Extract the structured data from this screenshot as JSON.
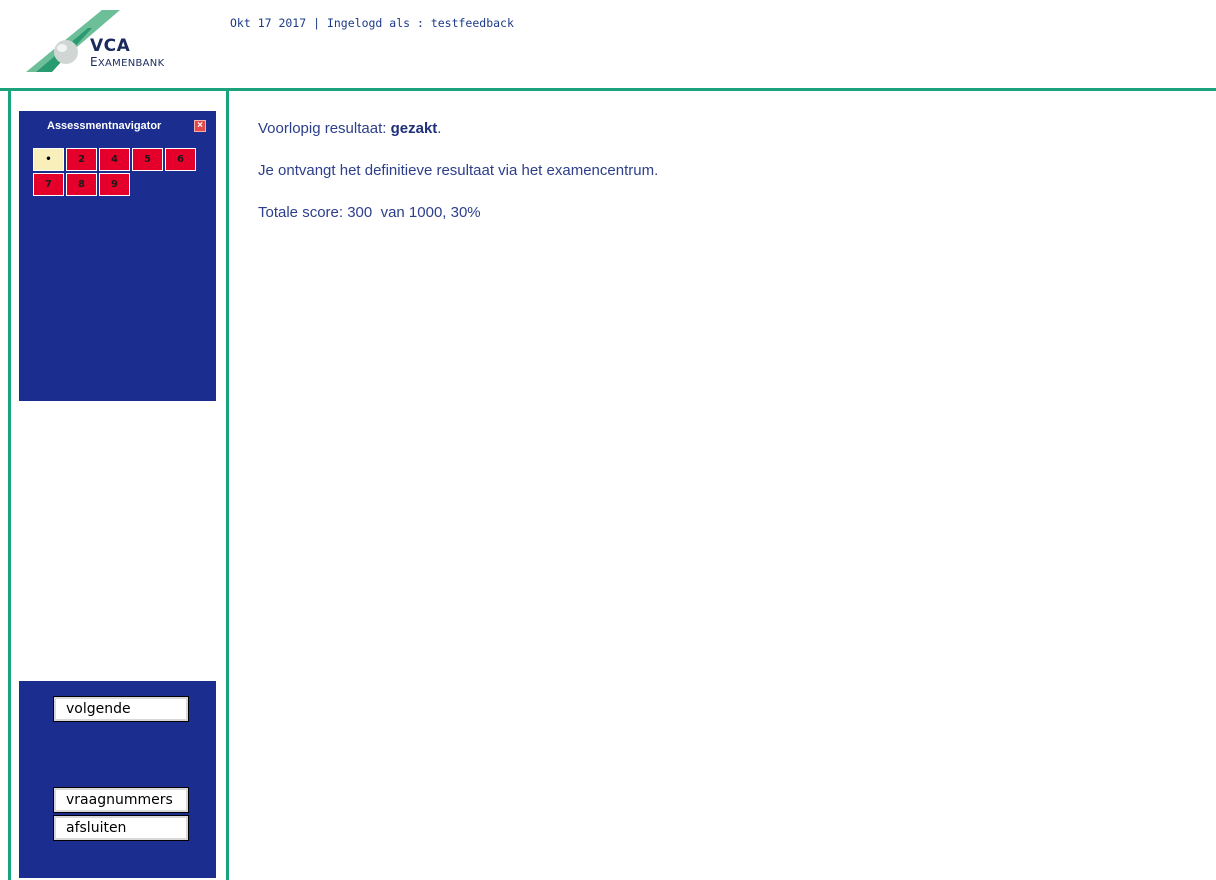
{
  "header": {
    "logo": {
      "title": "VCA",
      "subtitle_first": "E",
      "subtitle_rest": "XAMENBANK"
    },
    "date": "Okt 17 2017",
    "separator": " | ",
    "login_prefix": "Ingelogd als : ",
    "username": "testfeedback"
  },
  "navigator": {
    "title": "Assessmentnavigator",
    "close_label": "×",
    "items": [
      {
        "label": "•",
        "state": "current"
      },
      {
        "label": "2",
        "state": "answered"
      },
      {
        "label": "4",
        "state": "answered"
      },
      {
        "label": "5",
        "state": "answered"
      },
      {
        "label": "6",
        "state": "answered"
      },
      {
        "label": "7",
        "state": "answered"
      },
      {
        "label": "8",
        "state": "answered"
      },
      {
        "label": "9",
        "state": "answered"
      }
    ]
  },
  "buttons": {
    "next": "volgende",
    "question_numbers": "vraagnummers",
    "close": "afsluiten"
  },
  "result": {
    "prefix": "Voorlopig resultaat: ",
    "status": "gezakt",
    "suffix": ".",
    "notice": "Je ontvangt het definitieve resultaat via het examencentrum.",
    "score": "Totale score: 300  van 1000, 30%"
  },
  "colors": {
    "frame": "#1aa37c",
    "panel": "#1b2e8f",
    "cell": "#e4002b",
    "cell_current": "#f8efba",
    "text": "#2c3e8c"
  }
}
